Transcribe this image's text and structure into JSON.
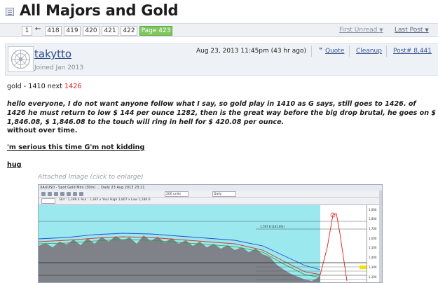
{
  "header": {
    "title": "All Majors and Gold",
    "title_icon": "thread-list-icon"
  },
  "pager": {
    "first": "1",
    "arrow": "←",
    "pages": [
      "418",
      "419",
      "420",
      "421",
      "422"
    ],
    "current": "Page 423",
    "first_unread": "First Unread",
    "last_post": "Last Post",
    "caret": "▼",
    "current_color": "#7fc65e"
  },
  "post": {
    "username": "takytto",
    "joined": "Joined Jan 2013",
    "timestamp": "Aug 23, 2013 11:45pm (43 hr ago)",
    "quote_label": "Quote",
    "cleanup_label": "Cleanup",
    "post_number": "Post# 8,441",
    "line1_prefix": "gold - 1410 next ",
    "line1_red": "1426",
    "para1": "hello everyone, I do not want anyone follow what I say, so gold play in 1410 as G says, still goes to 1426. of",
    "para2": "1426 he must return to low $ 144 per ounce 1282, then is the great way before the big drop brutal, he goes on $",
    "para3": "1,846.08, $ 1,846.08 to the touch will ring in hell for $ 420.08 per ounce.",
    "para4": "without over time.",
    "link1": "'m serious this time G'm not kidding",
    "link2": "hug",
    "attached": "Attached Image (click to enlarge)",
    "red_color": "#d42020",
    "link_color": "#2e4c8f"
  },
  "chart_image": {
    "window_title": "XAUUSD - Spot Gold Mini (30m) ... Daily 23 Aug 2013 23:11",
    "bid_line": "Bid : 1,396.4  Ask : 1,397.x  Year High 1,807.x  Low 1,180.6",
    "combo1": "200 units",
    "combo2": "Daily",
    "axis_labels": [
      "1,900",
      "1,800",
      "1,700",
      "1,600",
      "1,500",
      "1,400",
      "1,300",
      "1,200"
    ],
    "fib_label_top": "1,787.8 (161.8%)",
    "price_tag": "1,396.4"
  }
}
